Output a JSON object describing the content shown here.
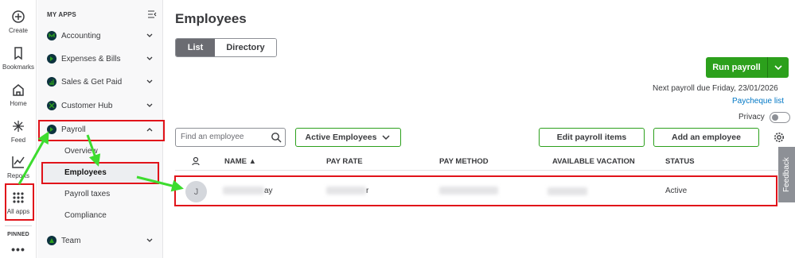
{
  "rail": {
    "create": "Create",
    "bookmarks": "Bookmarks",
    "home": "Home",
    "feed": "Feed",
    "reports": "Reports",
    "all_apps": "All apps",
    "pinned": "PINNED",
    "more": "•••"
  },
  "sidebar": {
    "heading": "MY APPS",
    "items": [
      {
        "label": "Accounting"
      },
      {
        "label": "Expenses & Bills"
      },
      {
        "label": "Sales & Get Paid"
      },
      {
        "label": "Customer Hub"
      },
      {
        "label": "Payroll"
      },
      {
        "label": "Team"
      }
    ],
    "payroll_sub": [
      "Overview",
      "Employees",
      "Payroll taxes",
      "Compliance"
    ]
  },
  "main": {
    "title": "Employees",
    "tabs": [
      "List",
      "Directory"
    ],
    "run_payroll": "Run payroll",
    "next_payroll": "Next payroll due Friday, 23/01/2026",
    "paycheque_list": "Paycheque list",
    "privacy": "Privacy",
    "search_placeholder": "Find an employee",
    "filter": "Active Employees",
    "edit_payroll": "Edit payroll items",
    "add_employee": "Add an employee",
    "feedback": "Feedback",
    "columns": [
      "NAME ▲",
      "PAY RATE",
      "PAY METHOD",
      "AVAILABLE VACATION",
      "STATUS"
    ],
    "row": {
      "avatar": "J",
      "name_suffix": "ay",
      "rate_suffix": "r",
      "status": "Active"
    }
  },
  "colors": {
    "accent_green": "#2ca01c",
    "annotation_red": "#e1131a",
    "link_blue": "#0077c5"
  }
}
